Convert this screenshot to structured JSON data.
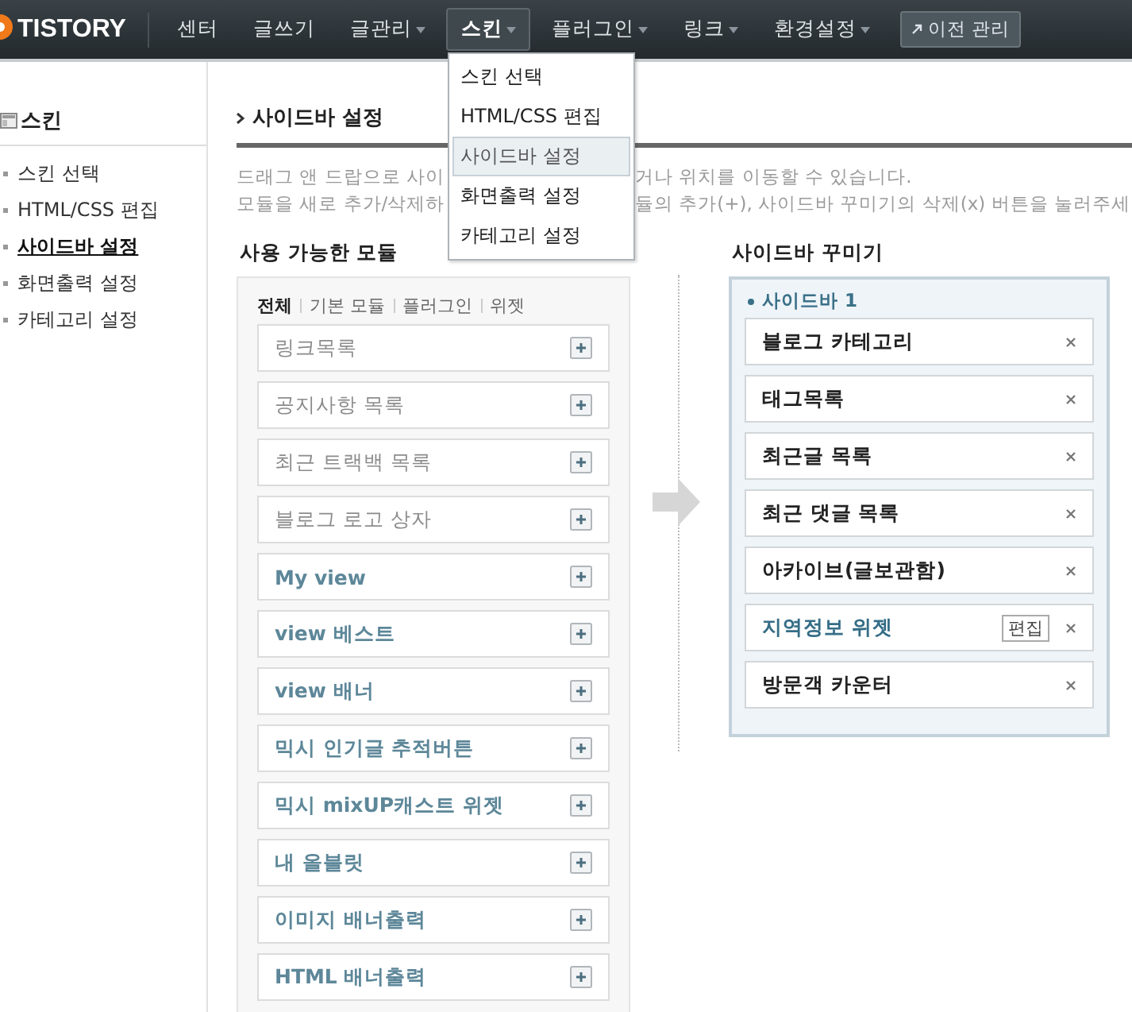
{
  "brand": {
    "logo": "TISTORY"
  },
  "nav": [
    {
      "label": "센터",
      "has_menu": false,
      "selected": false
    },
    {
      "label": "글쓰기",
      "has_menu": false,
      "selected": false
    },
    {
      "label": "글관리",
      "has_menu": true,
      "selected": false
    },
    {
      "label": "스킨",
      "has_menu": true,
      "selected": true
    },
    {
      "label": "플러그인",
      "has_menu": true,
      "selected": false
    },
    {
      "label": "링크",
      "has_menu": true,
      "selected": false
    },
    {
      "label": "환경설정",
      "has_menu": true,
      "selected": false
    }
  ],
  "legacy_button": "이전 관리",
  "dropdown": [
    {
      "label": "스킨 선택",
      "selected": false
    },
    {
      "label": "HTML/CSS 편집",
      "selected": false
    },
    {
      "label": "사이드바 설정",
      "selected": true
    },
    {
      "label": "화면출력 설정",
      "selected": false
    },
    {
      "label": "카테고리 설정",
      "selected": false
    }
  ],
  "sidebar": {
    "title": "스킨",
    "items": [
      {
        "label": "스킨 선택",
        "selected": false
      },
      {
        "label": "HTML/CSS 편집",
        "selected": false
      },
      {
        "label": "사이드바 설정",
        "selected": true
      },
      {
        "label": "화면출력 설정",
        "selected": false
      },
      {
        "label": "카테고리 설정",
        "selected": false
      }
    ]
  },
  "page": {
    "title": "사이드바 설정",
    "description": [
      {
        "before_menu": "드래그 앤 드랍으로 사이",
        "after_menu": "거나 위치를 이동할 수 있습니다."
      },
      {
        "before_menu": "모듈을 새로 추가/삭제하",
        "after_menu": "듈의 추가(+), 사이드바 꾸미기의 삭제(x) 버튼을 눌러주세"
      }
    ]
  },
  "modules": {
    "title": "사용 가능한 모듈",
    "filters": [
      {
        "label": "전체",
        "selected": true
      },
      {
        "label": "기본 모듈",
        "selected": false
      },
      {
        "label": "플러그인",
        "selected": false
      },
      {
        "label": "위젯",
        "selected": false
      }
    ],
    "items": [
      {
        "label": "링크목록",
        "kind": "basic"
      },
      {
        "label": "공지사항 목록",
        "kind": "basic"
      },
      {
        "label": "최근 트랙백 목록",
        "kind": "basic"
      },
      {
        "label": "블로그 로고 상자",
        "kind": "basic"
      },
      {
        "label": "My view",
        "kind": "plugin"
      },
      {
        "label": "view 베스트",
        "kind": "plugin"
      },
      {
        "label": "view 배너",
        "kind": "plugin"
      },
      {
        "label": "믹시 인기글 추적버튼",
        "kind": "plugin"
      },
      {
        "label": "믹시 mixUP캐스트 위젯",
        "kind": "plugin"
      },
      {
        "label": "내 올블릿",
        "kind": "plugin"
      },
      {
        "label": "이미지 배너출력",
        "kind": "plugin"
      },
      {
        "label": "HTML 배너출력",
        "kind": "plugin"
      }
    ]
  },
  "decorator": {
    "title": "사이드바 꾸미기",
    "group": "사이드바 1",
    "items": [
      {
        "label": "블로그 카테고리",
        "kind": "basic"
      },
      {
        "label": "태그목록",
        "kind": "basic"
      },
      {
        "label": "최근글 목록",
        "kind": "basic"
      },
      {
        "label": "최근 댓글 목록",
        "kind": "basic"
      },
      {
        "label": "아카이브(글보관함)",
        "kind": "basic"
      },
      {
        "label": "지역정보 위젯",
        "kind": "widget",
        "edit_label": "편집"
      },
      {
        "label": "방문객 카운터",
        "kind": "basic"
      }
    ]
  }
}
